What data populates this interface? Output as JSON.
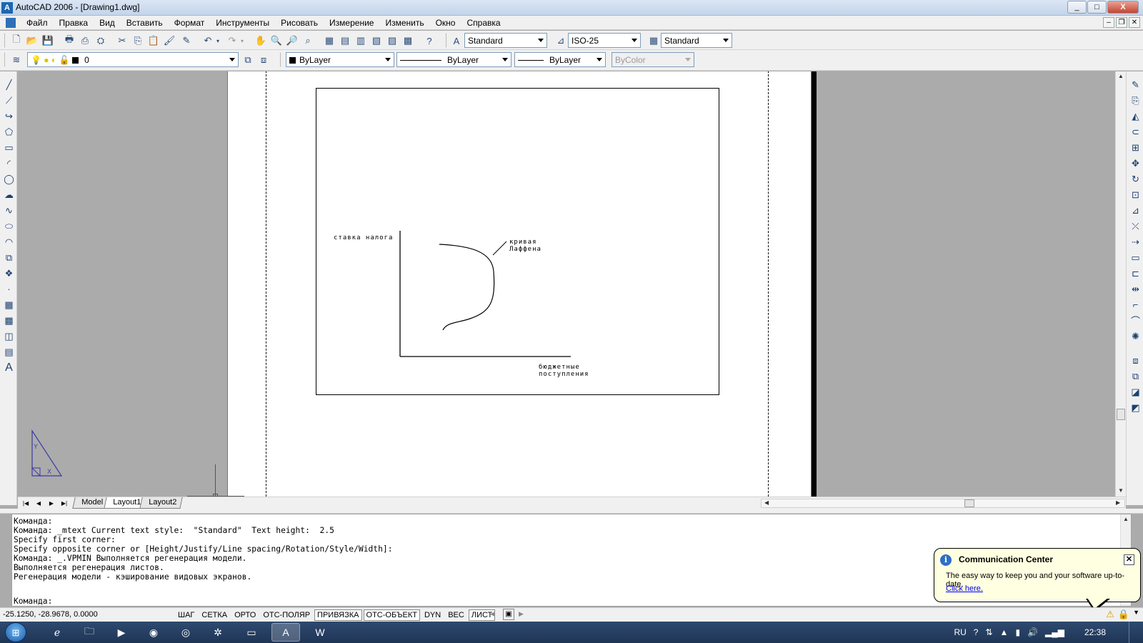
{
  "window": {
    "title": "AutoCAD 2006 - [Drawing1.dwg]",
    "min": "_",
    "max": "□",
    "close": "X"
  },
  "menu": [
    "Файл",
    "Правка",
    "Вид",
    "Вставить",
    "Формат",
    "Инструменты",
    "Рисовать",
    "Измерение",
    "Изменить",
    "Окно",
    "Справка"
  ],
  "toolbar": {
    "text_style": "Standard",
    "dim_style": "ISO-25",
    "table_style": "Standard"
  },
  "layers": {
    "current_layer": "0",
    "color": "ByLayer",
    "linetype": "ByLayer",
    "lineweight": "ByLayer",
    "plotstyle": "ByColor"
  },
  "drawing": {
    "y_label": "ставка налога",
    "curve_label_1": "кривая",
    "curve_label_2": "Лаффена",
    "x_label_1": "бюджетные",
    "x_label_2": "поступления",
    "ucs_y": "Y",
    "ucs_x": "X"
  },
  "tabs": [
    "Model",
    "Layout1",
    "Layout2"
  ],
  "active_tab": "Layout1",
  "command": {
    "lines": [
      "Команда:",
      "Команда: _mtext Current text style:  \"Standard\"  Text height:  2.5",
      "Specify first corner:",
      "Specify opposite corner or [Height/Justify/Line spacing/Rotation/Style/Width]:",
      "Команда: _.VPMIN Выполняется регенерация модели.",
      "Выполняется регенерация листов.",
      "Регенерация модели - кэширование видовых экранов."
    ],
    "prompt": "Команда:"
  },
  "balloon": {
    "title": "Communication Center",
    "text": "The easy way to keep you and your software up-to-date.",
    "link": "Click here."
  },
  "status": {
    "coords": "-25.1250, -28.9678, 0.0000",
    "toggles": [
      {
        "label": "ШАГ",
        "on": false
      },
      {
        "label": "СЕТКА",
        "on": false
      },
      {
        "label": "ОРТО",
        "on": false
      },
      {
        "label": "ОТС-ПОЛЯР",
        "on": false
      },
      {
        "label": "ПРИВЯЗКА",
        "on": true
      },
      {
        "label": "ОТС-ОБЪЕКТ",
        "on": true
      },
      {
        "label": "DYN",
        "on": false
      },
      {
        "label": "ВЕС",
        "on": false
      },
      {
        "label": "ЛИСТ",
        "on": true
      }
    ]
  },
  "taskbar": {
    "lang": "RU",
    "clock": "22:38"
  },
  "colors": {
    "canvas": "#ABABAB",
    "chrome": "#F0F0F0",
    "balloon": "#FFFFE1"
  }
}
